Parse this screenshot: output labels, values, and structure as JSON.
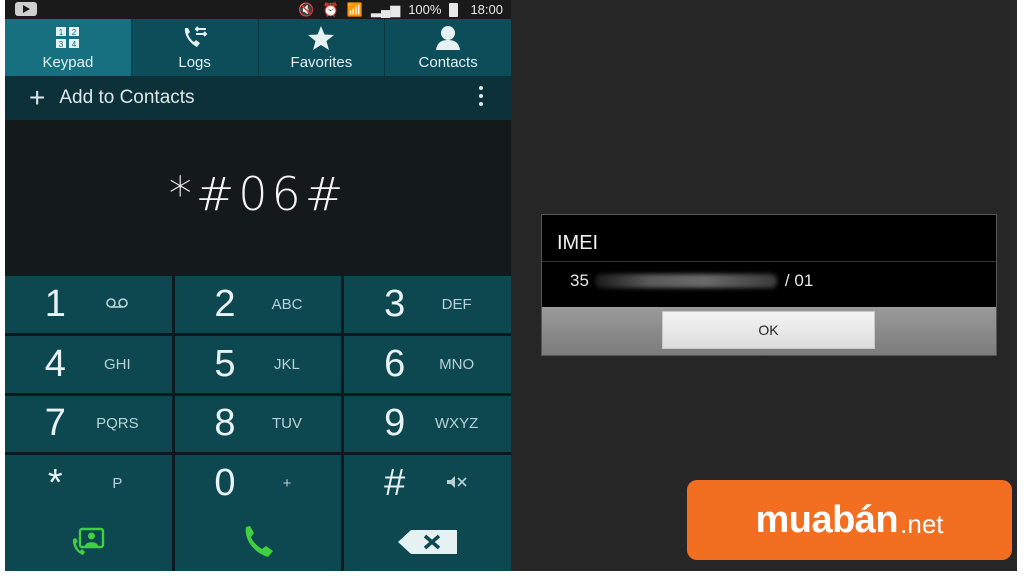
{
  "status_bar": {
    "battery_percent": "100%",
    "time": "18:00"
  },
  "tabs": [
    {
      "label": "Keypad",
      "icon": "keypad-icon",
      "active": true
    },
    {
      "label": "Logs",
      "icon": "call-log-icon",
      "active": false
    },
    {
      "label": "Favorites",
      "icon": "star-icon",
      "active": false
    },
    {
      "label": "Contacts",
      "icon": "person-icon",
      "active": false
    }
  ],
  "action_bar": {
    "add_label": "Add to Contacts"
  },
  "dialer": {
    "number": "*#06#"
  },
  "keypad": {
    "keys": [
      {
        "digit": "1",
        "letters": "",
        "sub_icon": "voicemail-icon"
      },
      {
        "digit": "2",
        "letters": "ABC"
      },
      {
        "digit": "3",
        "letters": "DEF"
      },
      {
        "digit": "4",
        "letters": "GHI"
      },
      {
        "digit": "5",
        "letters": "JKL"
      },
      {
        "digit": "6",
        "letters": "MNO"
      },
      {
        "digit": "7",
        "letters": "PQRS"
      },
      {
        "digit": "8",
        "letters": "TUV"
      },
      {
        "digit": "9",
        "letters": "WXYZ"
      },
      {
        "digit": "*",
        "letters": "P"
      },
      {
        "digit": "0",
        "letters": "+"
      },
      {
        "digit": "#",
        "letters": "",
        "sub_icon": "mute-icon"
      }
    ]
  },
  "dialog": {
    "title": "IMEI",
    "imei_prefix": "35",
    "imei_suffix": "/ 01",
    "ok_label": "OK"
  },
  "watermark": {
    "text": "muabán",
    "suffix": ".net"
  },
  "colors": {
    "tab_active": "#17707f",
    "tab_bg": "#0d4d5a",
    "key_bg": "#0d4750",
    "call_green": "#3fcf3f",
    "watermark_orange": "#f26e21"
  }
}
